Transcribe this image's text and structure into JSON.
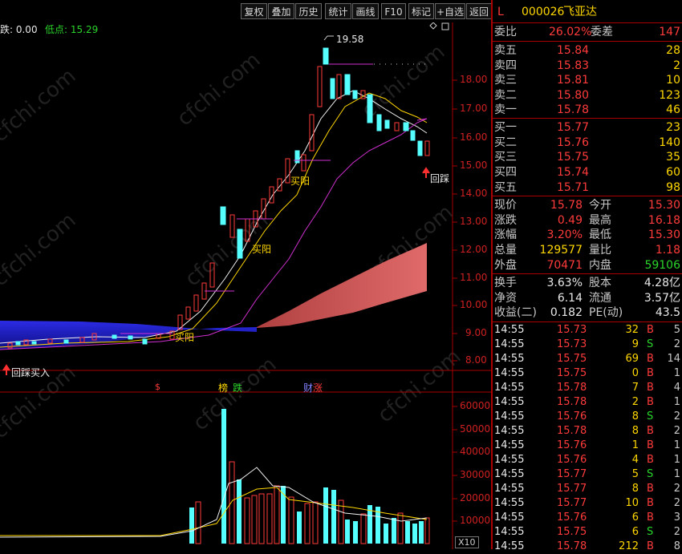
{
  "toolbar": {
    "buttons": [
      "复权",
      "叠加",
      "历史",
      "统计",
      "画线",
      "F10",
      "标记",
      "+自选",
      "返回"
    ]
  },
  "chart": {
    "info_left": "跌: 0.00",
    "info_low": "低点: 15.29",
    "high_mark": "19.58",
    "price_axis": [
      "18.00",
      "17.00",
      "16.00",
      "15.00",
      "14.00",
      "13.00",
      "12.00",
      "11.00",
      "10.00",
      "9.00",
      "8.00"
    ],
    "volume_axis": [
      "60000",
      "50000",
      "40000",
      "30000",
      "20000",
      "10000"
    ],
    "volume_unit": "X10",
    "signals": {
      "buy_pullback_1": "回踩买入",
      "buy_pullback_2": "回踩",
      "buy_yang_1": "买阳",
      "buy_yang_2": "买阳",
      "buy_yang_3": "买阳"
    },
    "event_marks": {
      "m1": "$",
      "m2": "榜",
      "m3": "跌",
      "m4": "财",
      "m5": "涨"
    },
    "watermark": "cfchi.com"
  },
  "quote": {
    "header_l": "L",
    "code": "000026",
    "name": "飞亚达",
    "weibi_label": "委比",
    "weibi_value": "26.02%",
    "weicha_label": "委差",
    "weicha_value": "147",
    "asks": [
      {
        "label": "卖五",
        "price": "15.84",
        "vol": "28"
      },
      {
        "label": "卖四",
        "price": "15.83",
        "vol": "2"
      },
      {
        "label": "卖三",
        "price": "15.81",
        "vol": "10"
      },
      {
        "label": "卖二",
        "price": "15.80",
        "vol": "123"
      },
      {
        "label": "卖一",
        "price": "15.78",
        "vol": "46"
      }
    ],
    "bids": [
      {
        "label": "买一",
        "price": "15.77",
        "vol": "23"
      },
      {
        "label": "买二",
        "price": "15.76",
        "vol": "140"
      },
      {
        "label": "买三",
        "price": "15.75",
        "vol": "35"
      },
      {
        "label": "买四",
        "price": "15.74",
        "vol": "60"
      },
      {
        "label": "买五",
        "price": "15.71",
        "vol": "98"
      }
    ],
    "stats": [
      {
        "l1": "现价",
        "v1": "15.78",
        "c1": "red",
        "l2": "今开",
        "v2": "15.30",
        "c2": "red"
      },
      {
        "l1": "涨跌",
        "v1": "0.49",
        "c1": "red",
        "l2": "最高",
        "v2": "16.18",
        "c2": "red"
      },
      {
        "l1": "涨幅",
        "v1": "3.20%",
        "c1": "red",
        "l2": "最低",
        "v2": "15.30",
        "c2": "red"
      },
      {
        "l1": "总量",
        "v1": "129577",
        "c1": "yellow",
        "l2": "量比",
        "v2": "1.18",
        "c2": "red"
      },
      {
        "l1": "外盘",
        "v1": "70471",
        "c1": "red",
        "l2": "内盘",
        "v2": "59106",
        "c2": "green"
      }
    ],
    "stats2": [
      {
        "l1": "换手",
        "v1": "3.63%",
        "l2": "股本",
        "v2": "4.28亿"
      },
      {
        "l1": "净资",
        "v1": "6.14",
        "l2": "流通",
        "v2": "3.57亿"
      },
      {
        "l1": "收益(二)",
        "v1": "0.182",
        "l2": "PE(动)",
        "v2": "43.5"
      }
    ],
    "ticks": [
      {
        "t": "14:55",
        "p": "15.73",
        "v": "32",
        "s": "B",
        "n": "5"
      },
      {
        "t": "14:55",
        "p": "15.73",
        "v": "9",
        "s": "S",
        "n": "2"
      },
      {
        "t": "14:55",
        "p": "15.75",
        "v": "69",
        "s": "B",
        "n": "14"
      },
      {
        "t": "14:55",
        "p": "15.75",
        "v": "0",
        "s": "B",
        "n": "1"
      },
      {
        "t": "14:55",
        "p": "15.78",
        "v": "7",
        "s": "B",
        "n": "4"
      },
      {
        "t": "14:55",
        "p": "15.78",
        "v": "2",
        "s": "B",
        "n": "1"
      },
      {
        "t": "14:55",
        "p": "15.76",
        "v": "8",
        "s": "S",
        "n": "2"
      },
      {
        "t": "14:55",
        "p": "15.78",
        "v": "8",
        "s": "B",
        "n": "2"
      },
      {
        "t": "14:55",
        "p": "15.76",
        "v": "1",
        "s": "B",
        "n": "1"
      },
      {
        "t": "14:55",
        "p": "15.76",
        "v": "4",
        "s": "B",
        "n": "1"
      },
      {
        "t": "14:55",
        "p": "15.77",
        "v": "5",
        "s": "S",
        "n": "1"
      },
      {
        "t": "14:55",
        "p": "15.77",
        "v": "8",
        "s": "B",
        "n": "2"
      },
      {
        "t": "14:55",
        "p": "15.77",
        "v": "10",
        "s": "B",
        "n": "2"
      },
      {
        "t": "14:55",
        "p": "15.76",
        "v": "6",
        "s": "B",
        "n": "3"
      },
      {
        "t": "14:55",
        "p": "15.75",
        "v": "6",
        "s": "S",
        "n": "2"
      },
      {
        "t": "14:55",
        "p": "15.78",
        "v": "212",
        "s": "B",
        "n": "8"
      }
    ]
  }
}
